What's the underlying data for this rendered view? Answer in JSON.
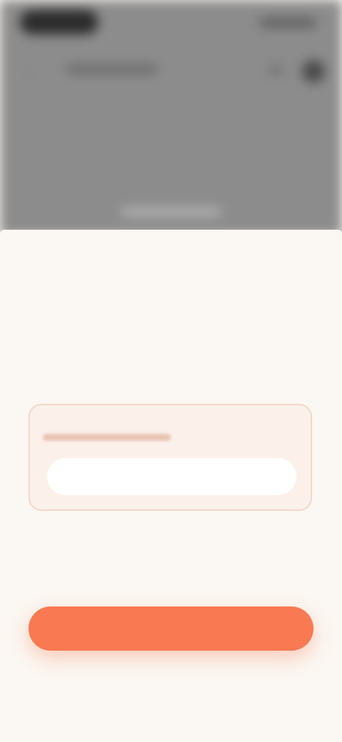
{
  "underlay": {
    "back_icon": "arrow-left-icon",
    "header_actions": [
      "share-icon",
      "avatar"
    ]
  },
  "sheet": {
    "title": "",
    "description": "",
    "section_label": "",
    "option_card": {
      "line1": "",
      "button_label": ""
    },
    "secondary_label": "",
    "primary_button_label": "",
    "cancel_label": ""
  },
  "colors": {
    "sheet_background": "#fbf7f2",
    "accent": "#f97a52",
    "card_border": "#f3d7c8",
    "overlay": "#8c8c8c"
  }
}
